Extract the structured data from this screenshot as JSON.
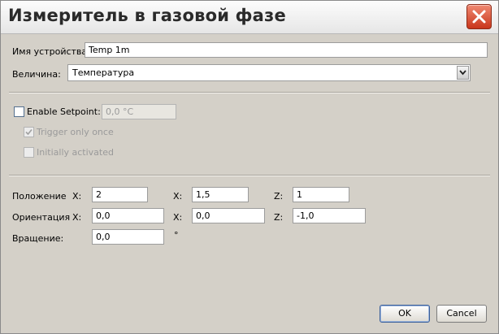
{
  "window": {
    "title": "Измеритель в газовой фазе"
  },
  "device_name": {
    "label": "Имя устройства:",
    "value": "Temp 1m"
  },
  "quantity": {
    "label": "Величина:",
    "selected": "Температура"
  },
  "setpoint": {
    "enable_label": "Enable Setpoint:",
    "enabled": false,
    "value": "0,0 °C",
    "trigger_once_label": "Trigger only once",
    "trigger_once_checked": true,
    "initially_activated_label": "Initially activated",
    "initially_activated_checked": false
  },
  "position": {
    "label": "Положение",
    "x_label": "X:",
    "x": "2",
    "y_label": "X:",
    "y": "1,5",
    "z_label": "Z:",
    "z": "1"
  },
  "orientation": {
    "label": "Ориентация",
    "x_label": "X:",
    "x": "0,0",
    "y_label": "X:",
    "y": "0,0",
    "z_label": "Z:",
    "z": "-1,0"
  },
  "rotation": {
    "label": "Вращение:",
    "value": "0,0",
    "unit": "°"
  },
  "buttons": {
    "ok": "OK",
    "cancel": "Cancel"
  },
  "colors": {
    "dialog_bg": "#d4d0c8",
    "close_button": "#c9361b"
  }
}
